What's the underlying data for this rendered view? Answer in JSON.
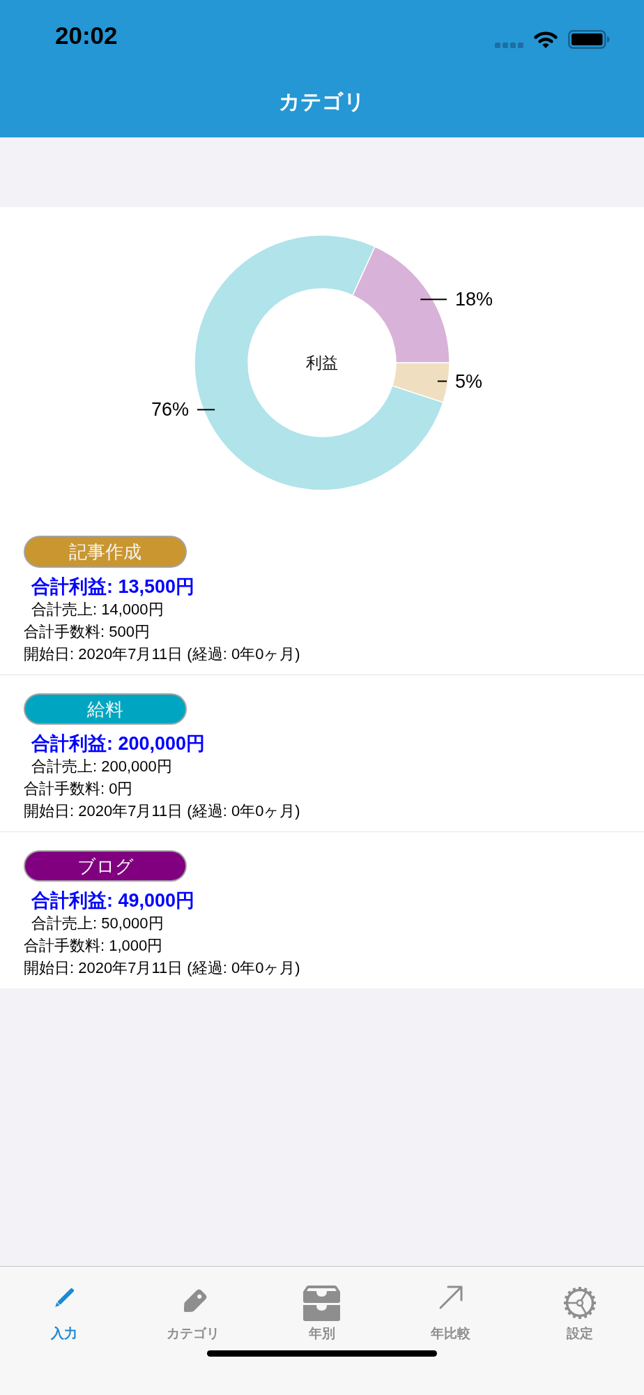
{
  "status_bar": {
    "time": "20:02"
  },
  "nav_bar": {
    "title": "カテゴリ"
  },
  "chart": {
    "center_label": "利益",
    "chart_data": {
      "type": "donut",
      "values": [
        5,
        76,
        18
      ],
      "colors": [
        "#efdfc0",
        "#b0e3ea",
        "#d8b2d8"
      ],
      "value_labels": [
        "5%",
        "76%",
        "18%"
      ]
    }
  },
  "categories": [
    {
      "name": "記事作成",
      "color": "#c9962f",
      "profit": "合計利益: 13,500円",
      "sales": "合計売上: 14,000円",
      "fees": "合計手数料: 500円",
      "start": "開始日: 2020年7月11日 (経過: 0年0ヶ月)"
    },
    {
      "name": "給料",
      "color": "#00a6c1",
      "profit": "合計利益: 200,000円",
      "sales": "合計売上: 200,000円",
      "fees": "合計手数料: 0円",
      "start": "開始日: 2020年7月11日 (経過: 0年0ヶ月)"
    },
    {
      "name": "ブログ",
      "color": "#800080",
      "profit": "合計利益: 49,000円",
      "sales": "合計売上: 50,000円",
      "fees": "合計手数料: 1,000円",
      "start": "開始日: 2020年7月11日 (経過: 0年0ヶ月)"
    }
  ],
  "tab_bar": {
    "tabs": [
      {
        "label": "入力",
        "selected": true
      },
      {
        "label": "カテゴリ",
        "selected": false
      },
      {
        "label": "年別",
        "selected": false
      },
      {
        "label": "年比較",
        "selected": false
      },
      {
        "label": "設定",
        "selected": false
      }
    ]
  }
}
